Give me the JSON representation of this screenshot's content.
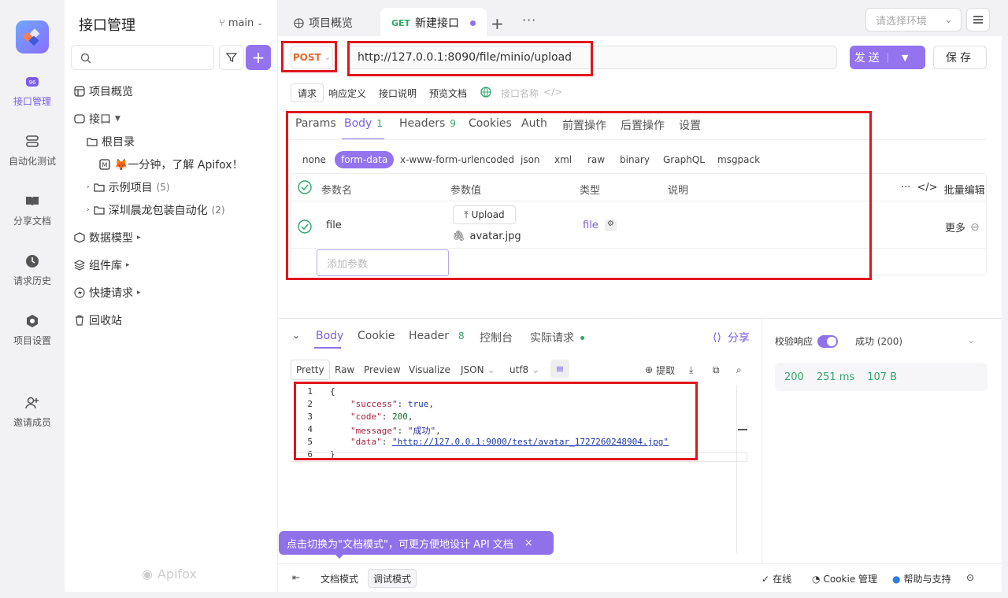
{
  "rail": {
    "items": [
      {
        "label": "接口管理",
        "icon": "api-icon"
      },
      {
        "label": "自动化测试",
        "icon": "automation-icon"
      },
      {
        "label": "分享文档",
        "icon": "book-icon"
      },
      {
        "label": "请求历史",
        "icon": "clock-icon"
      },
      {
        "label": "项目设置",
        "icon": "settings-icon"
      },
      {
        "label": "邀请成员",
        "icon": "add-user-icon"
      }
    ]
  },
  "sidebar": {
    "title": "接口管理",
    "branch": "main",
    "tree": [
      {
        "label": "项目概览"
      },
      {
        "label": "接口"
      },
      {
        "label": "根目录"
      },
      {
        "label": "🦊一分钟，了解 Apifox！"
      },
      {
        "label": "示例项目",
        "count": "(5)"
      },
      {
        "label": "深圳晨龙包装自动化",
        "count": "(2)"
      },
      {
        "label": "数据模型"
      },
      {
        "label": "组件库"
      },
      {
        "label": "快捷请求"
      },
      {
        "label": "回收站"
      }
    ]
  },
  "topbar": {
    "tabs": [
      {
        "label": "项目概览"
      },
      {
        "method": "GET",
        "label": "新建接口"
      }
    ],
    "env_placeholder": "请选择环境"
  },
  "request": {
    "method": "POST",
    "url": "http://127.0.0.1:8090/file/minio/upload",
    "send_label": "发送",
    "save_label": "保存",
    "subtabs": [
      "请求",
      "响应定义",
      "接口说明",
      "预览文档"
    ],
    "name_placeholder": "接口名称",
    "param_tabs": [
      {
        "label": "Params"
      },
      {
        "label": "Body",
        "count": "1"
      },
      {
        "label": "Headers",
        "count": "9"
      },
      {
        "label": "Cookies"
      },
      {
        "label": "Auth"
      },
      {
        "label": "前置操作"
      },
      {
        "label": "后置操作"
      },
      {
        "label": "设置"
      }
    ],
    "body_types": [
      "none",
      "form-data",
      "x-www-form-urlencoded",
      "json",
      "xml",
      "raw",
      "binary",
      "GraphQL",
      "msgpack"
    ],
    "columns": [
      "参数名",
      "参数值",
      "类型",
      "说明"
    ],
    "bulk_edit": "批量编辑",
    "row": {
      "name": "file",
      "upload": "Upload",
      "filename": "avatar.jpg",
      "type": "file",
      "more": "更多"
    },
    "add_param_placeholder": "添加参数"
  },
  "response": {
    "tabs": [
      {
        "label": "Body"
      },
      {
        "label": "Cookie"
      },
      {
        "label": "Header",
        "count": "8"
      },
      {
        "label": "控制台"
      },
      {
        "label": "实际请求"
      }
    ],
    "share": "分享",
    "view_modes": [
      "Pretty",
      "Raw",
      "Preview",
      "Visualize"
    ],
    "format": "JSON",
    "encoding": "utf8",
    "extract": "提取",
    "code_lines": [
      "1",
      "2",
      "3",
      "4",
      "5",
      "6"
    ],
    "json": {
      "success_key": "\"success\"",
      "success_val": "true",
      "code_key": "\"code\"",
      "code_val": "200",
      "message_key": "\"message\"",
      "message_val": "\"成功\"",
      "data_key": "\"data\"",
      "data_val": "\"http://127.0.0.1:9000/test/avatar_1727260248904.jpg\""
    },
    "validate_label": "校验响应",
    "validate_status": "成功 (200)",
    "status_code": "200",
    "time": "251 ms",
    "size": "107 B"
  },
  "bottom": {
    "tooltip": "点击切换为\"文档模式\"，可更方便地设计 API 文档",
    "modes": [
      "文档模式",
      "调试模式"
    ],
    "online": "在线",
    "cookie_mgr": "Cookie 管理",
    "help": "帮助与支持",
    "watermark": "Apifox"
  },
  "colors": {
    "accent": "#9373ee",
    "post": "#e2672b",
    "get": "#2ea56b",
    "highlight": "#e0161e"
  }
}
